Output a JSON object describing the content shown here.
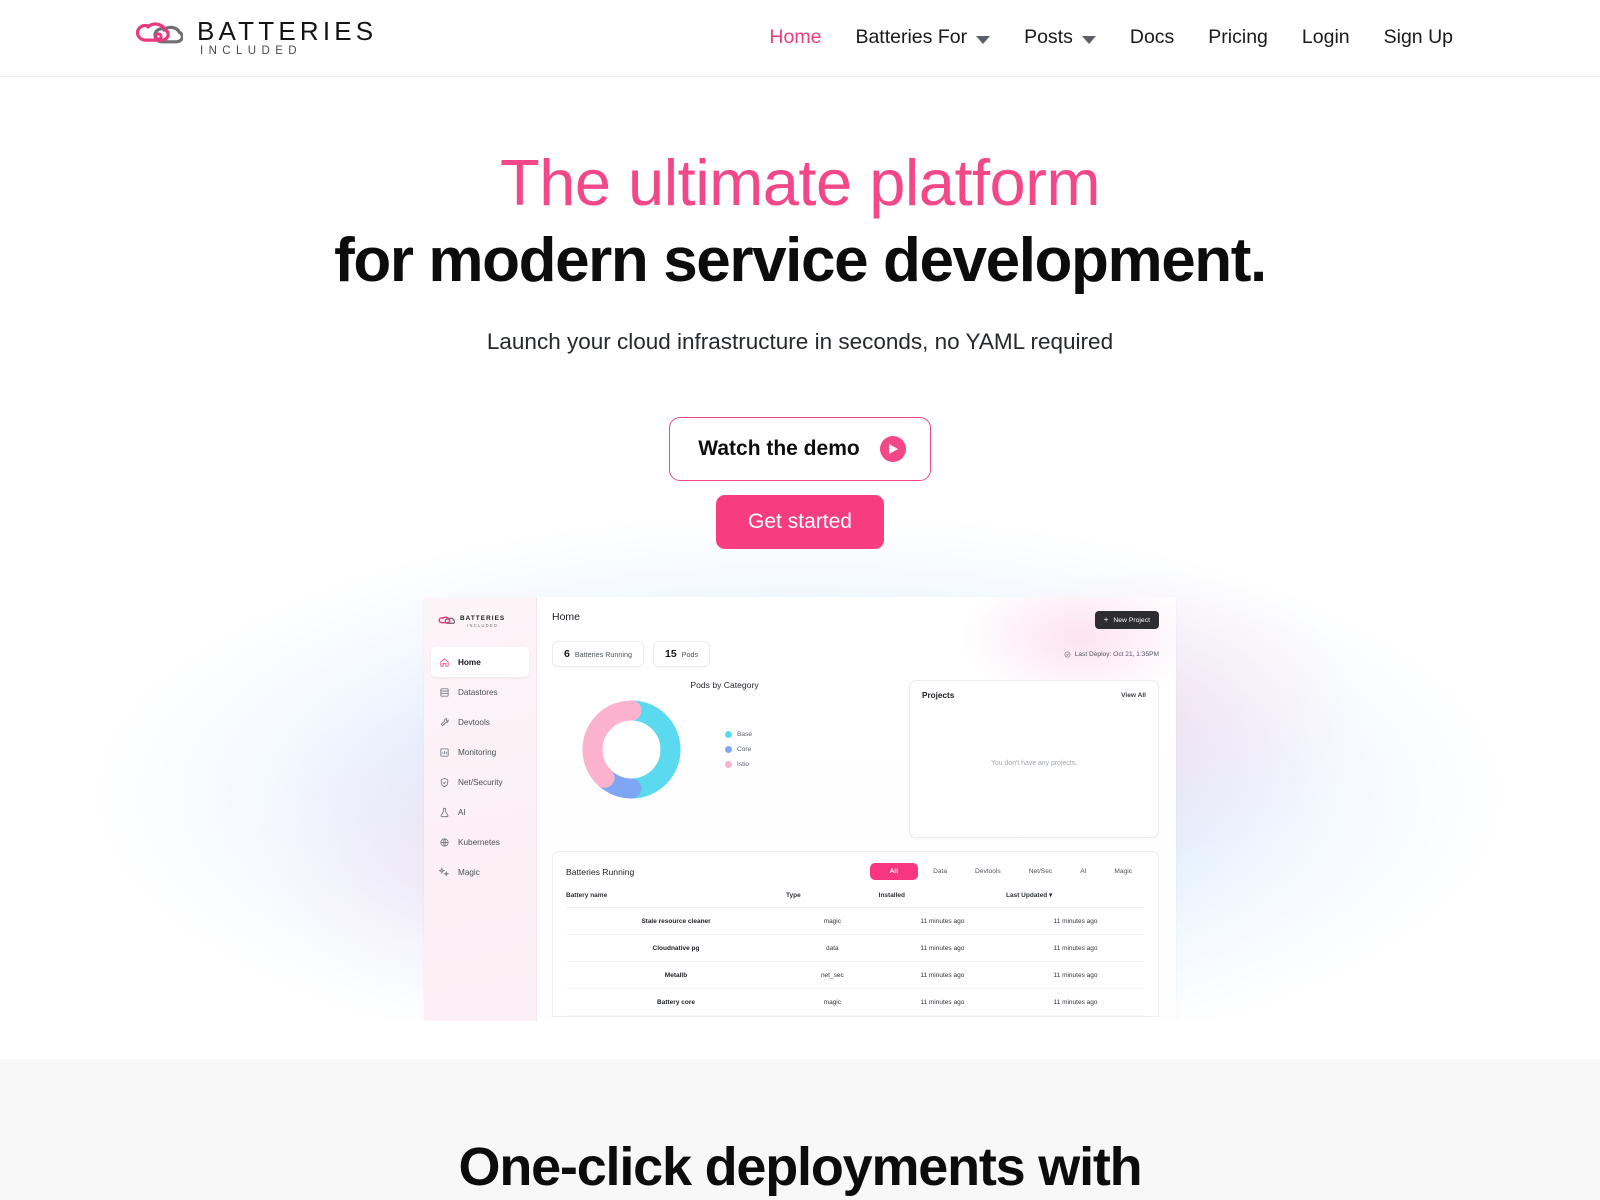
{
  "header": {
    "brand": {
      "name": "BATTERIES",
      "tagline": "INCLUDED",
      "logo_icon": "cloud-logo-icon"
    },
    "nav": [
      {
        "label": "Home",
        "active": true,
        "caret": false
      },
      {
        "label": "Batteries For",
        "active": false,
        "caret": true
      },
      {
        "label": "Posts",
        "active": false,
        "caret": true
      },
      {
        "label": "Docs",
        "active": false,
        "caret": false
      },
      {
        "label": "Pricing",
        "active": false,
        "caret": false
      },
      {
        "label": "Login",
        "active": false,
        "caret": false
      },
      {
        "label": "Sign Up",
        "active": false,
        "caret": false
      }
    ]
  },
  "hero": {
    "headline_line1": "The ultimate platform",
    "headline_line2": "for modern service development.",
    "subhead": "Launch your cloud infrastructure in seconds, no YAML required",
    "demo_button": "Watch the demo",
    "start_button": "Get started",
    "accent_pink": "#f2488a",
    "cta_pink": "#f73d80"
  },
  "dashboard": {
    "sidebar": {
      "brand_top": "BATTERIES",
      "brand_sub": "INCLUDED",
      "items": [
        {
          "label": "Home",
          "icon": "home-icon",
          "active": true
        },
        {
          "label": "Datastores",
          "icon": "database-icon",
          "active": false
        },
        {
          "label": "Devtools",
          "icon": "wrench-icon",
          "active": false
        },
        {
          "label": "Monitoring",
          "icon": "chart-icon",
          "active": false
        },
        {
          "label": "Net/Security",
          "icon": "shield-check-icon",
          "active": false
        },
        {
          "label": "AI",
          "icon": "flask-icon",
          "active": false
        },
        {
          "label": "Kubernetes",
          "icon": "globe-icon",
          "active": false
        },
        {
          "label": "Magic",
          "icon": "sparkles-icon",
          "active": false
        }
      ]
    },
    "page_title": "Home",
    "new_project_button": "New Project",
    "new_project_plus": "+",
    "stats": [
      {
        "value": "6",
        "label": "Batteries Running"
      },
      {
        "value": "15",
        "label": "Pods"
      }
    ],
    "last_deploy": "Last Deploy: Oct 21, 1:35PM",
    "projects": {
      "title": "Projects",
      "view_all": "View All",
      "empty_message": "You don't have any projects."
    },
    "table": {
      "title": "Batteries Running",
      "tabs": [
        {
          "label": "All",
          "active": true
        },
        {
          "label": "Data",
          "active": false
        },
        {
          "label": "Devtools",
          "active": false
        },
        {
          "label": "Net/Sec",
          "active": false
        },
        {
          "label": "AI",
          "active": false
        },
        {
          "label": "Magic",
          "active": false
        }
      ],
      "columns": [
        "Battery name",
        "Type",
        "Installed",
        "Last Updated ▾"
      ],
      "rows": [
        {
          "name": "Stale resource cleaner",
          "type": "magic",
          "installed": "11 minutes ago",
          "updated": "11 minutes ago"
        },
        {
          "name": "Cloudnative pg",
          "type": "data",
          "installed": "11 minutes ago",
          "updated": "11 minutes ago"
        },
        {
          "name": "Metallb",
          "type": "net_sec",
          "installed": "11 minutes ago",
          "updated": "11 minutes ago"
        },
        {
          "name": "Battery core",
          "type": "magic",
          "installed": "11 minutes ago",
          "updated": "11 minutes ago"
        }
      ]
    }
  },
  "chart_data": {
    "type": "pie",
    "title": "Pods by Category",
    "categories": [
      "Base",
      "Core",
      "Istio"
    ],
    "values": [
      50,
      12,
      38
    ],
    "colors": [
      "#5ad9ef",
      "#7fa6f5",
      "#fbb2cd"
    ],
    "legend_position": "right",
    "donut": true,
    "xlabel": "",
    "ylabel": ""
  },
  "section2": {
    "title": "One-click deployments with"
  }
}
